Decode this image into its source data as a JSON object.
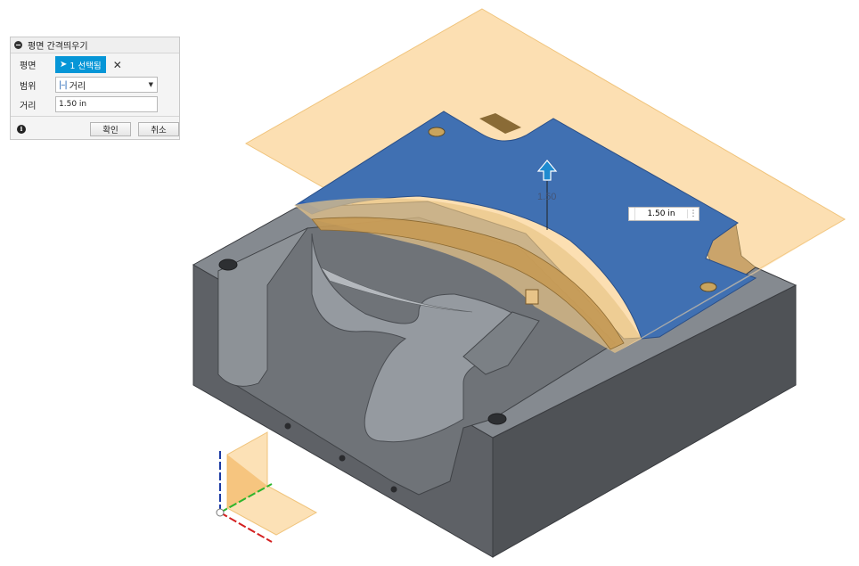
{
  "dialog": {
    "title": "평면 간격띄우기",
    "face_label": "평면",
    "selection_label": "1 선택됨",
    "extent_label": "범위",
    "extent_value": "거리",
    "distance_label": "거리",
    "distance_value": "1.50 in",
    "ok_label": "확인",
    "cancel_label": "취소"
  },
  "viewport": {
    "dimension_text": "1.50",
    "value_box": "1.50 in"
  },
  "colors": {
    "accent": "#0696d7",
    "plane_fill": "#fbd7a0",
    "selected_face": "#3f6cb0",
    "body_gray": "#6b6e72"
  }
}
